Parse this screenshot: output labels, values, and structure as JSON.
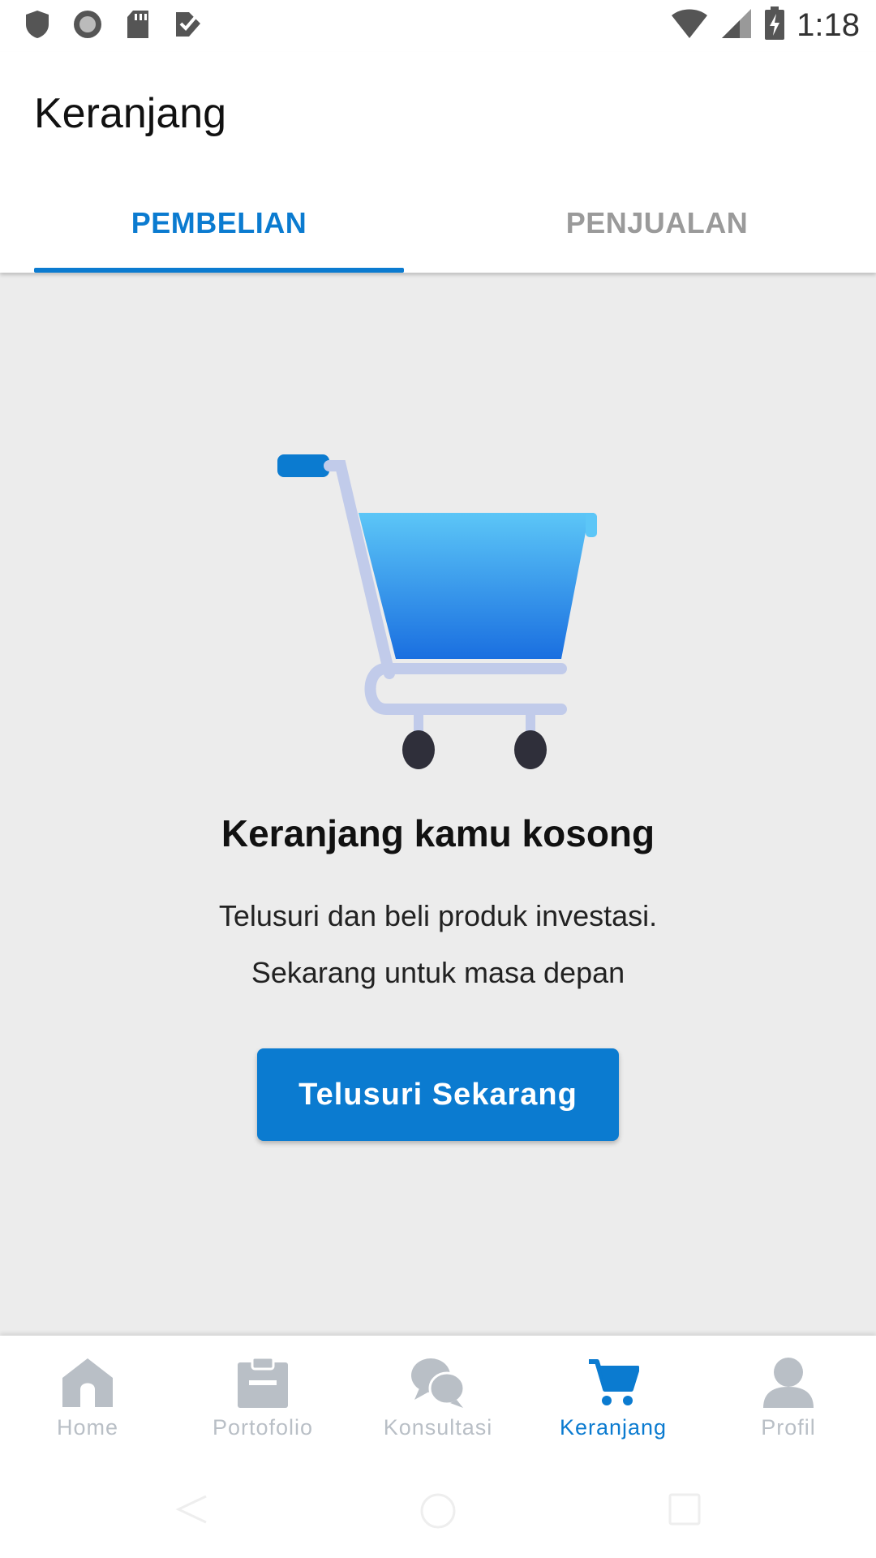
{
  "status_bar": {
    "time": "1:18",
    "left_icons": [
      "shield-icon",
      "circle-icon",
      "sd-card-icon",
      "check-tag-icon"
    ],
    "right_icons": [
      "wifi-icon",
      "signal-icon",
      "battery-charging-icon"
    ]
  },
  "appbar": {
    "title": "Keranjang",
    "tabs": [
      {
        "label": "PEMBELIAN",
        "active": true
      },
      {
        "label": "PENJUALAN",
        "active": false
      }
    ]
  },
  "empty_state": {
    "title": "Keranjang kamu kosong",
    "line1": "Telusuri dan beli produk investasi.",
    "line2": "Sekarang untuk masa depan",
    "button_label": "Telusuri Sekarang",
    "illustration": "shopping-cart-icon"
  },
  "bottom_nav": {
    "items": [
      {
        "label": "Home",
        "icon": "home-icon",
        "active": false
      },
      {
        "label": "Portofolio",
        "icon": "clipboard-icon",
        "active": false
      },
      {
        "label": "Konsultasi",
        "icon": "chat-icon",
        "active": false
      },
      {
        "label": "Keranjang",
        "icon": "cart-icon",
        "active": true
      },
      {
        "label": "Profil",
        "icon": "person-icon",
        "active": false
      }
    ]
  },
  "colors": {
    "accent": "#0b7bd0",
    "inactive": "#b9bfc6",
    "background": "#ececec"
  }
}
